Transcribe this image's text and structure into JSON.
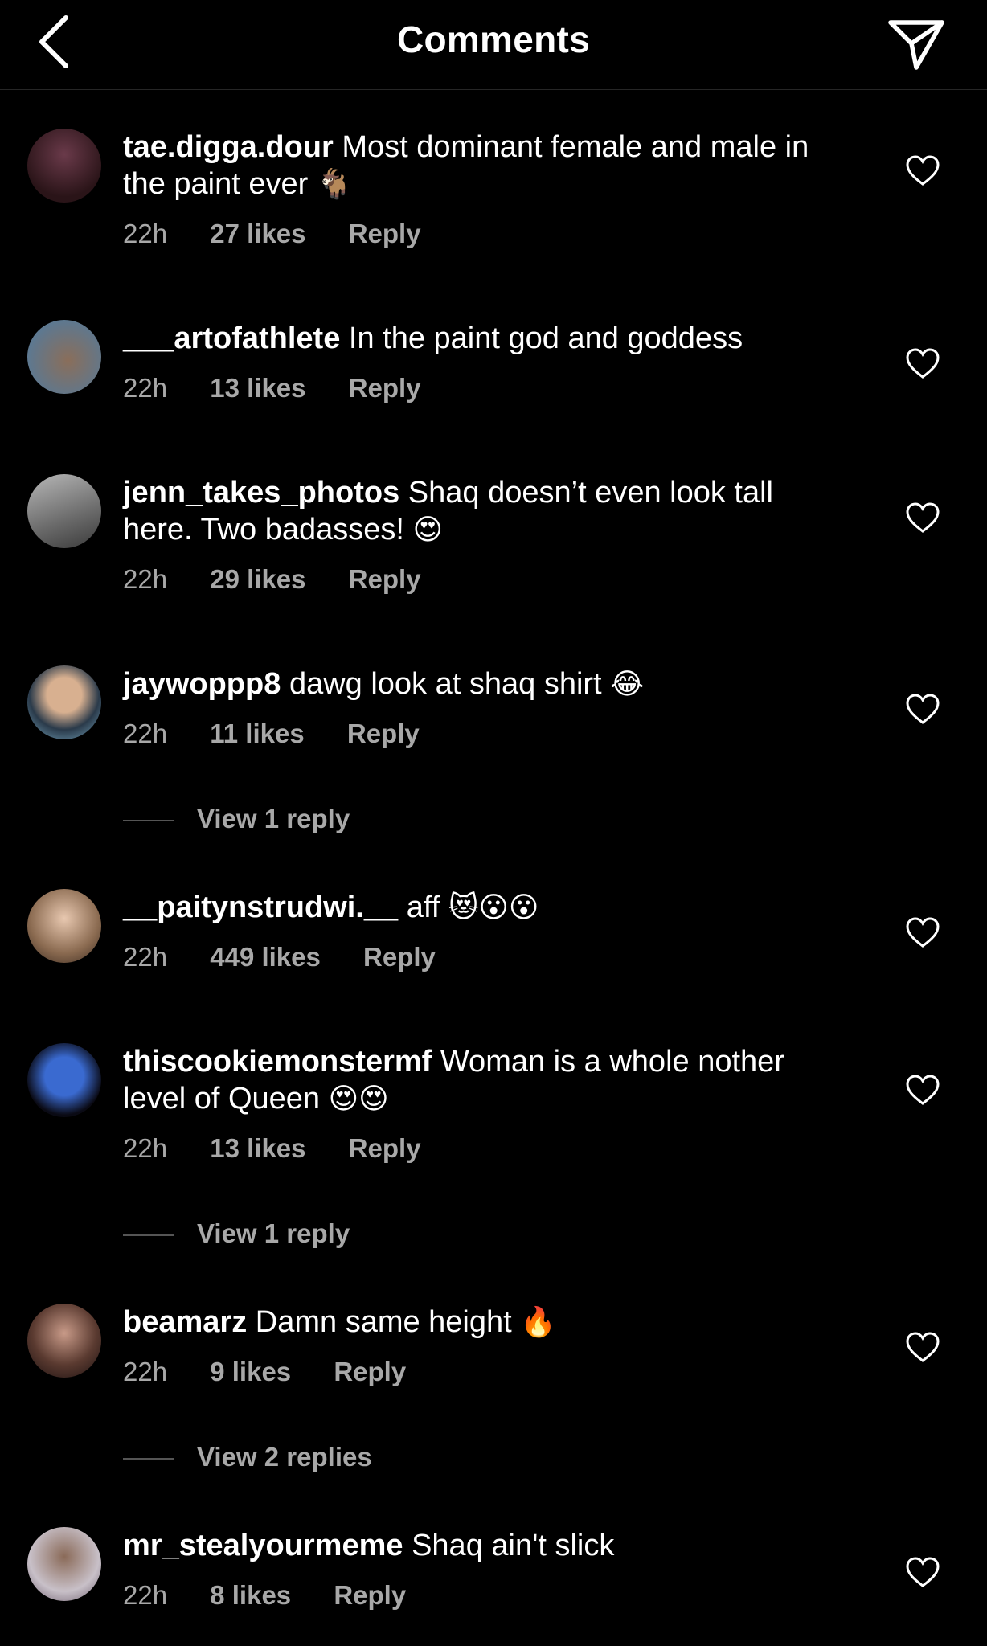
{
  "header": {
    "title": "Comments"
  },
  "icons": {
    "back": "chevron-left-icon",
    "share": "paper-plane-icon",
    "like": "heart-outline-icon"
  },
  "colors": {
    "background": "#000000",
    "text": "#ffffff",
    "muted": "#a8a8a8"
  },
  "comments": [
    {
      "user": "tae.digga.dour",
      "text": "Most dominant female and male in the paint ever",
      "emoji": "🐐",
      "time": "22h",
      "likes": "27 likes",
      "reply": "Reply"
    },
    {
      "user": "___artofathlete",
      "text": "In the paint god and goddess",
      "emoji": "",
      "time": "22h",
      "likes": "13 likes",
      "reply": "Reply"
    },
    {
      "user": "jenn_takes_photos",
      "text": "Shaq doesn’t even look tall here.  Two badasses!",
      "emoji": "😍",
      "time": "22h",
      "likes": "29 likes",
      "reply": "Reply"
    },
    {
      "user": "jaywoppp8",
      "text": "dawg look at shaq shirt",
      "emoji": "😂",
      "time": "22h",
      "likes": "11 likes",
      "reply": "Reply",
      "view_replies": "View 1 reply"
    },
    {
      "user": "__paitynstrudwi.__",
      "text": "aff",
      "emoji": "😻😮😮",
      "time": "22h",
      "likes": "449 likes",
      "reply": "Reply"
    },
    {
      "user": "thiscookiemonstermf",
      "text": "Woman is a whole nother level of Queen",
      "emoji": "😍😍",
      "time": "22h",
      "likes": "13 likes",
      "reply": "Reply",
      "view_replies": "View 1 reply"
    },
    {
      "user": "beamarz",
      "text": "Damn same height",
      "emoji": "🔥",
      "time": "22h",
      "likes": "9 likes",
      "reply": "Reply",
      "view_replies": "View 2 replies"
    },
    {
      "user": "mr_stealyourmeme",
      "text": "Shaq ain't slick",
      "emoji": "",
      "time": "22h",
      "likes": "8 likes",
      "reply": "Reply"
    }
  ]
}
